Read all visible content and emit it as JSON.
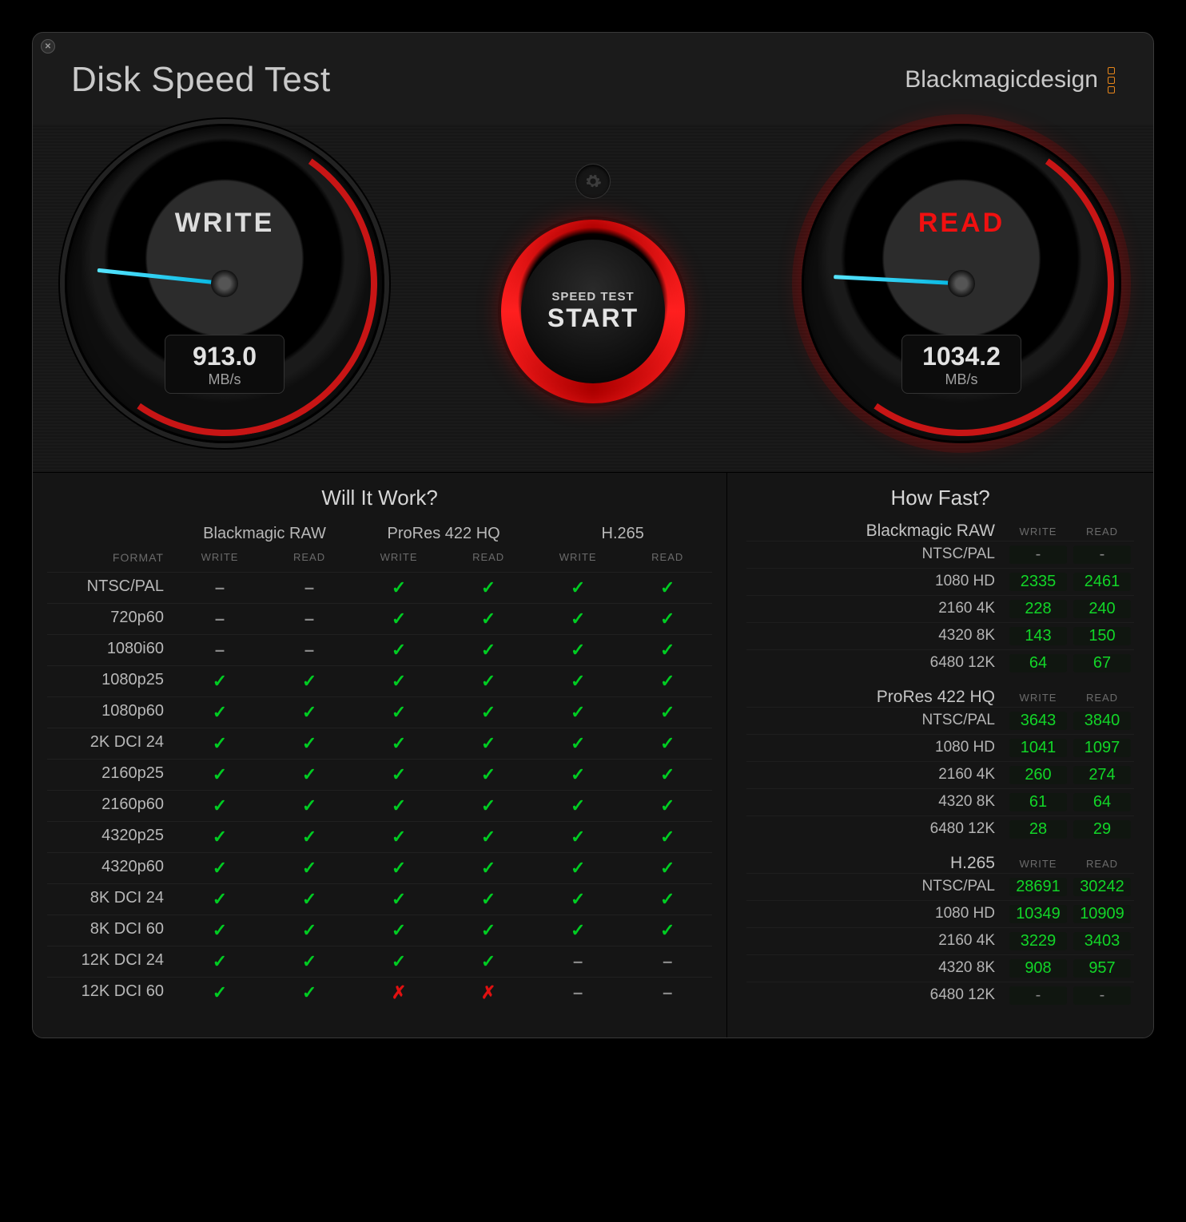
{
  "header": {
    "title": "Disk Speed Test",
    "brand": "Blackmagicdesign"
  },
  "gauges": {
    "write": {
      "label": "WRITE",
      "value": "913.0",
      "unit": "MB/s"
    },
    "read": {
      "label": "READ",
      "value": "1034.2",
      "unit": "MB/s"
    }
  },
  "start": {
    "line1": "SPEED TEST",
    "line2": "START"
  },
  "will_it_work": {
    "title": "Will It Work?",
    "format_header": "FORMAT",
    "codecs": [
      "Blackmagic RAW",
      "ProRes 422 HQ",
      "H.265"
    ],
    "sub": [
      "WRITE",
      "READ"
    ],
    "rows": [
      {
        "f": "NTSC/PAL",
        "c": [
          "-",
          "-",
          "y",
          "y",
          "y",
          "y"
        ]
      },
      {
        "f": "720p60",
        "c": [
          "-",
          "-",
          "y",
          "y",
          "y",
          "y"
        ]
      },
      {
        "f": "1080i60",
        "c": [
          "-",
          "-",
          "y",
          "y",
          "y",
          "y"
        ]
      },
      {
        "f": "1080p25",
        "c": [
          "y",
          "y",
          "y",
          "y",
          "y",
          "y"
        ]
      },
      {
        "f": "1080p60",
        "c": [
          "y",
          "y",
          "y",
          "y",
          "y",
          "y"
        ]
      },
      {
        "f": "2K DCI 24",
        "c": [
          "y",
          "y",
          "y",
          "y",
          "y",
          "y"
        ]
      },
      {
        "f": "2160p25",
        "c": [
          "y",
          "y",
          "y",
          "y",
          "y",
          "y"
        ]
      },
      {
        "f": "2160p60",
        "c": [
          "y",
          "y",
          "y",
          "y",
          "y",
          "y"
        ]
      },
      {
        "f": "4320p25",
        "c": [
          "y",
          "y",
          "y",
          "y",
          "y",
          "y"
        ]
      },
      {
        "f": "4320p60",
        "c": [
          "y",
          "y",
          "y",
          "y",
          "y",
          "y"
        ]
      },
      {
        "f": "8K DCI 24",
        "c": [
          "y",
          "y",
          "y",
          "y",
          "y",
          "y"
        ]
      },
      {
        "f": "8K DCI 60",
        "c": [
          "y",
          "y",
          "y",
          "y",
          "y",
          "y"
        ]
      },
      {
        "f": "12K DCI 24",
        "c": [
          "y",
          "y",
          "y",
          "y",
          "-",
          "-"
        ]
      },
      {
        "f": "12K DCI 60",
        "c": [
          "y",
          "y",
          "x",
          "x",
          "-",
          "-"
        ]
      }
    ]
  },
  "how_fast": {
    "title": "How Fast?",
    "sub": [
      "WRITE",
      "READ"
    ],
    "groups": [
      {
        "codec": "Blackmagic RAW",
        "rows": [
          {
            "f": "NTSC/PAL",
            "w": "-",
            "r": "-"
          },
          {
            "f": "1080 HD",
            "w": "2335",
            "r": "2461"
          },
          {
            "f": "2160 4K",
            "w": "228",
            "r": "240"
          },
          {
            "f": "4320 8K",
            "w": "143",
            "r": "150"
          },
          {
            "f": "6480 12K",
            "w": "64",
            "r": "67"
          }
        ]
      },
      {
        "codec": "ProRes 422 HQ",
        "rows": [
          {
            "f": "NTSC/PAL",
            "w": "3643",
            "r": "3840"
          },
          {
            "f": "1080 HD",
            "w": "1041",
            "r": "1097"
          },
          {
            "f": "2160 4K",
            "w": "260",
            "r": "274"
          },
          {
            "f": "4320 8K",
            "w": "61",
            "r": "64"
          },
          {
            "f": "6480 12K",
            "w": "28",
            "r": "29"
          }
        ]
      },
      {
        "codec": "H.265",
        "rows": [
          {
            "f": "NTSC/PAL",
            "w": "28691",
            "r": "30242"
          },
          {
            "f": "1080 HD",
            "w": "10349",
            "r": "10909"
          },
          {
            "f": "2160 4K",
            "w": "3229",
            "r": "3403"
          },
          {
            "f": "4320 8K",
            "w": "908",
            "r": "957"
          },
          {
            "f": "6480 12K",
            "w": "-",
            "r": "-"
          }
        ]
      }
    ]
  },
  "chart_data": {
    "type": "table",
    "title": "Disk Speed Test",
    "gauges": {
      "write_mbps": 913.0,
      "read_mbps": 1034.2
    },
    "how_fast_fps": {
      "Blackmagic RAW": {
        "NTSC/PAL": [
          null,
          null
        ],
        "1080 HD": [
          2335,
          2461
        ],
        "2160 4K": [
          228,
          240
        ],
        "4320 8K": [
          143,
          150
        ],
        "6480 12K": [
          64,
          67
        ]
      },
      "ProRes 422 HQ": {
        "NTSC/PAL": [
          3643,
          3840
        ],
        "1080 HD": [
          1041,
          1097
        ],
        "2160 4K": [
          260,
          274
        ],
        "4320 8K": [
          61,
          64
        ],
        "6480 12K": [
          28,
          29
        ]
      },
      "H.265": {
        "NTSC/PAL": [
          28691,
          30242
        ],
        "1080 HD": [
          10349,
          10909
        ],
        "2160 4K": [
          3229,
          3403
        ],
        "4320 8K": [
          908,
          957
        ],
        "6480 12K": [
          null,
          null
        ]
      }
    }
  }
}
